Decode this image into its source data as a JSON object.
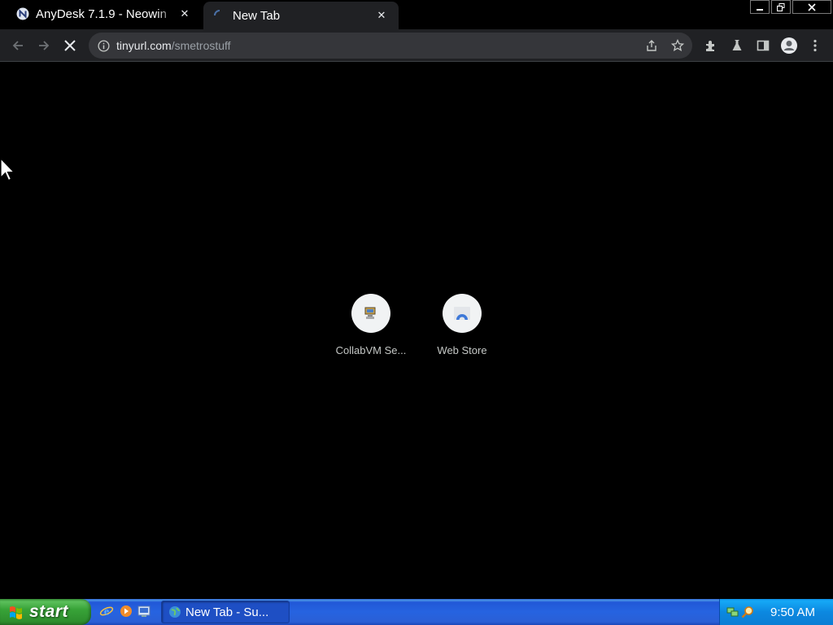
{
  "browser": {
    "tabs": [
      {
        "title": "AnyDesk 7.1.9 - Neowin",
        "favicon": "neowin-icon",
        "active": false
      },
      {
        "title": "New Tab",
        "favicon": "loading-spinner-icon",
        "active": true
      }
    ],
    "omnibox": {
      "domain": "tinyurl.com",
      "path": "/smetrostuff"
    }
  },
  "new_tab": {
    "shortcuts": [
      {
        "label": "CollabVM Se...",
        "icon": "collabvm-icon"
      },
      {
        "label": "Web Store",
        "icon": "web-store-icon"
      }
    ]
  },
  "taskbar": {
    "start_label": "start",
    "task_button": "New Tab - Su...",
    "clock": "9:50 AM"
  },
  "colors": {
    "tab_active": "#202124",
    "toolbar": "#202124",
    "omnibox": "#35363a",
    "taskbar_blue": "#2663e0",
    "start_green": "#38a338",
    "tray_blue": "#0c88e0"
  }
}
